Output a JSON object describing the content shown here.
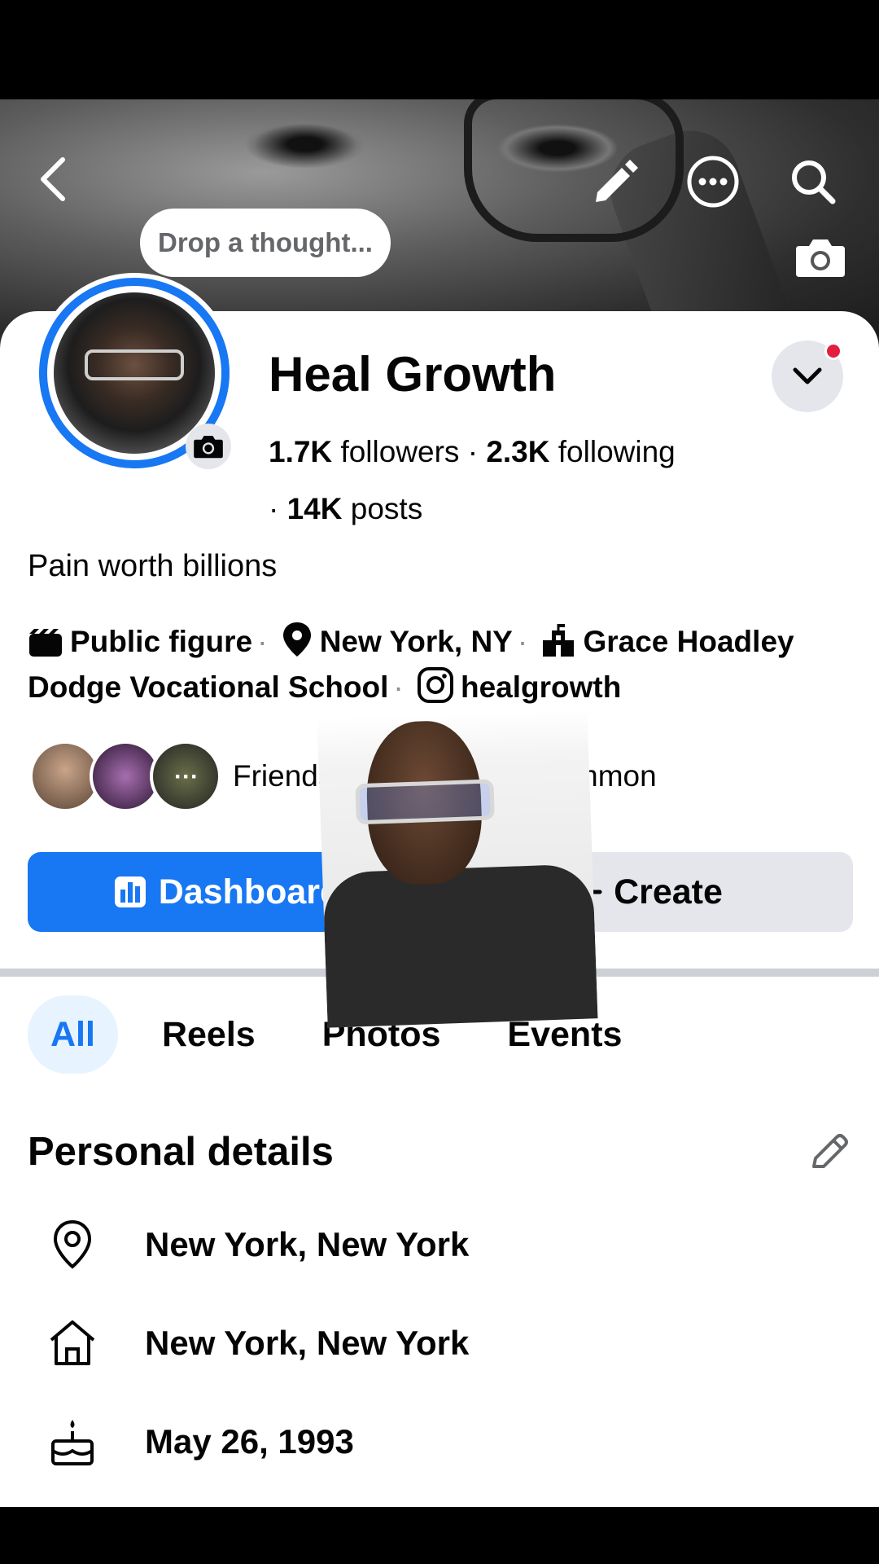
{
  "header": {
    "thought_placeholder": "Drop a thought..."
  },
  "profile": {
    "name": "Heal Growth",
    "followers_count": "1.7K",
    "followers_label": "followers",
    "following_count": "2.3K",
    "following_label": "following",
    "posts_count": "14K",
    "posts_label": "posts",
    "bio": "Pain worth billions"
  },
  "intro": {
    "category": "Public figure",
    "location": "New York, NY",
    "school": "Grace Hoadley Dodge Vocational School",
    "instagram": "healgrowth"
  },
  "friends": {
    "text": "Friends w",
    "text_tail": "gs in common"
  },
  "actions": {
    "dashboard_label": "Dashboard",
    "create_label": "Create"
  },
  "tabs": [
    {
      "label": "All",
      "active": true
    },
    {
      "label": "Reels",
      "active": false
    },
    {
      "label": "Photos",
      "active": false
    },
    {
      "label": "Events",
      "active": false
    }
  ],
  "personal_details": {
    "title": "Personal details",
    "items": [
      {
        "icon": "location-pin-icon",
        "text": "New York, New York"
      },
      {
        "icon": "home-icon",
        "text": "New York, New York"
      },
      {
        "icon": "birthday-cake-icon",
        "text": "May 26, 1993"
      }
    ]
  },
  "colors": {
    "accent": "#1877f2",
    "notification": "#e41e3f",
    "secondary_button": "#e4e6eb"
  }
}
